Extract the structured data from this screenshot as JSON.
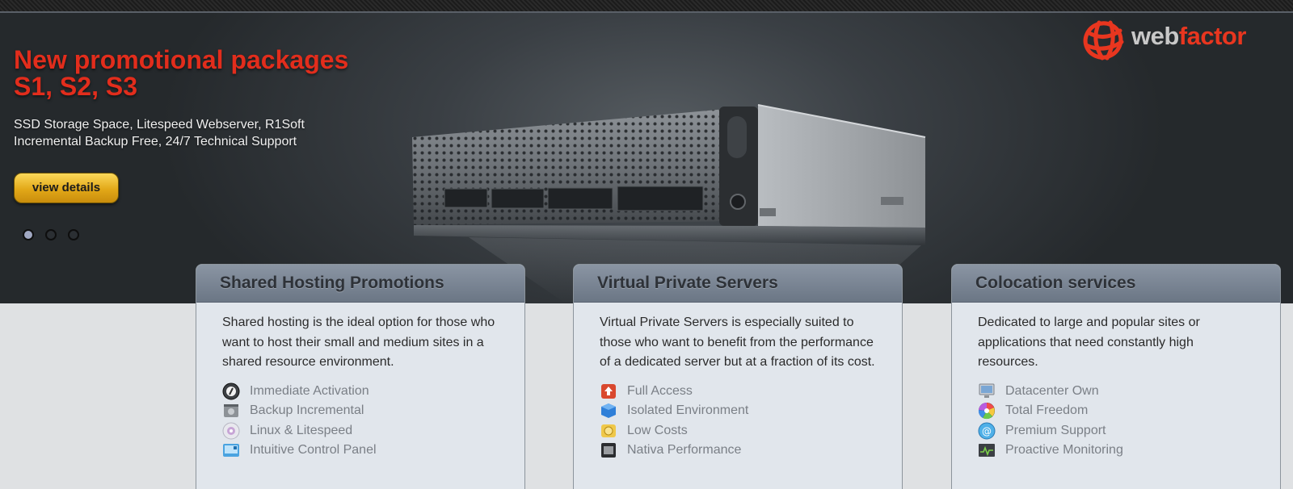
{
  "brand": {
    "part1": "web",
    "part2": "factor"
  },
  "hero": {
    "title": "New promotional packages S1, S2, S3",
    "description": "SSD Storage Space, Litespeed Webserver, R1Soft Incremental Backup Free, 24/7 Technical Support",
    "button_label": "view details",
    "slides": 3,
    "active_slide": 1
  },
  "cards": [
    {
      "title": "Shared Hosting Promotions",
      "description": "Shared hosting is the ideal option for those who want to host their small and medium sites in a shared resource environment.",
      "features": [
        {
          "label": "Immediate Activation",
          "icon": "speedometer-icon"
        },
        {
          "label": "Backup Incremental",
          "icon": "hard-drive-icon"
        },
        {
          "label": "Linux & Litespeed",
          "icon": "disc-icon"
        },
        {
          "label": "Intuitive Control Panel",
          "icon": "control-panel-icon"
        }
      ]
    },
    {
      "title": "Virtual Private Servers",
      "description": "Virtual Private Servers is especially suited to those who want to benefit from the performance of a dedicated server but at a fraction of its cost.",
      "features": [
        {
          "label": "Full Access",
          "icon": "upload-icon"
        },
        {
          "label": "Isolated Environment",
          "icon": "cube-icon"
        },
        {
          "label": "Low Costs",
          "icon": "coins-icon"
        },
        {
          "label": "Nativa Performance",
          "icon": "chip-icon"
        }
      ]
    },
    {
      "title": "Colocation services",
      "description": "Dedicated to large and popular sites or applications that need constantly high resources.",
      "features": [
        {
          "label": "Datacenter Own",
          "icon": "monitor-icon"
        },
        {
          "label": "Total Freedom",
          "icon": "color-wheel-icon"
        },
        {
          "label": "Premium Support",
          "icon": "at-sign-icon"
        },
        {
          "label": "Proactive Monitoring",
          "icon": "activity-monitor-icon"
        }
      ]
    }
  ]
}
